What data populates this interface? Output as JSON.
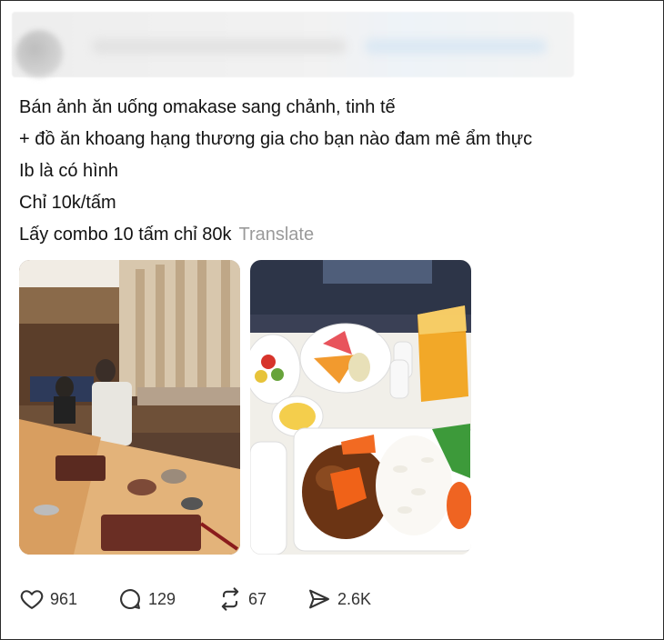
{
  "post": {
    "lines": [
      "Bán ảnh ăn uống omakase sang chảnh, tinh tế",
      "+ đồ ăn khoang hạng thương gia cho bạn nào đam mê ẩm thực",
      "Ib là có hình",
      "Chỉ 10k/tấm",
      "Lấy combo 10 tấm chỉ 80k"
    ],
    "translate_label": "Translate"
  },
  "media": [
    {
      "icon": "omakase-restaurant-photo"
    },
    {
      "icon": "business-class-meal-photo"
    }
  ],
  "actions": {
    "likes": "961",
    "replies": "129",
    "reposts": "67",
    "shares": "2.6K"
  }
}
